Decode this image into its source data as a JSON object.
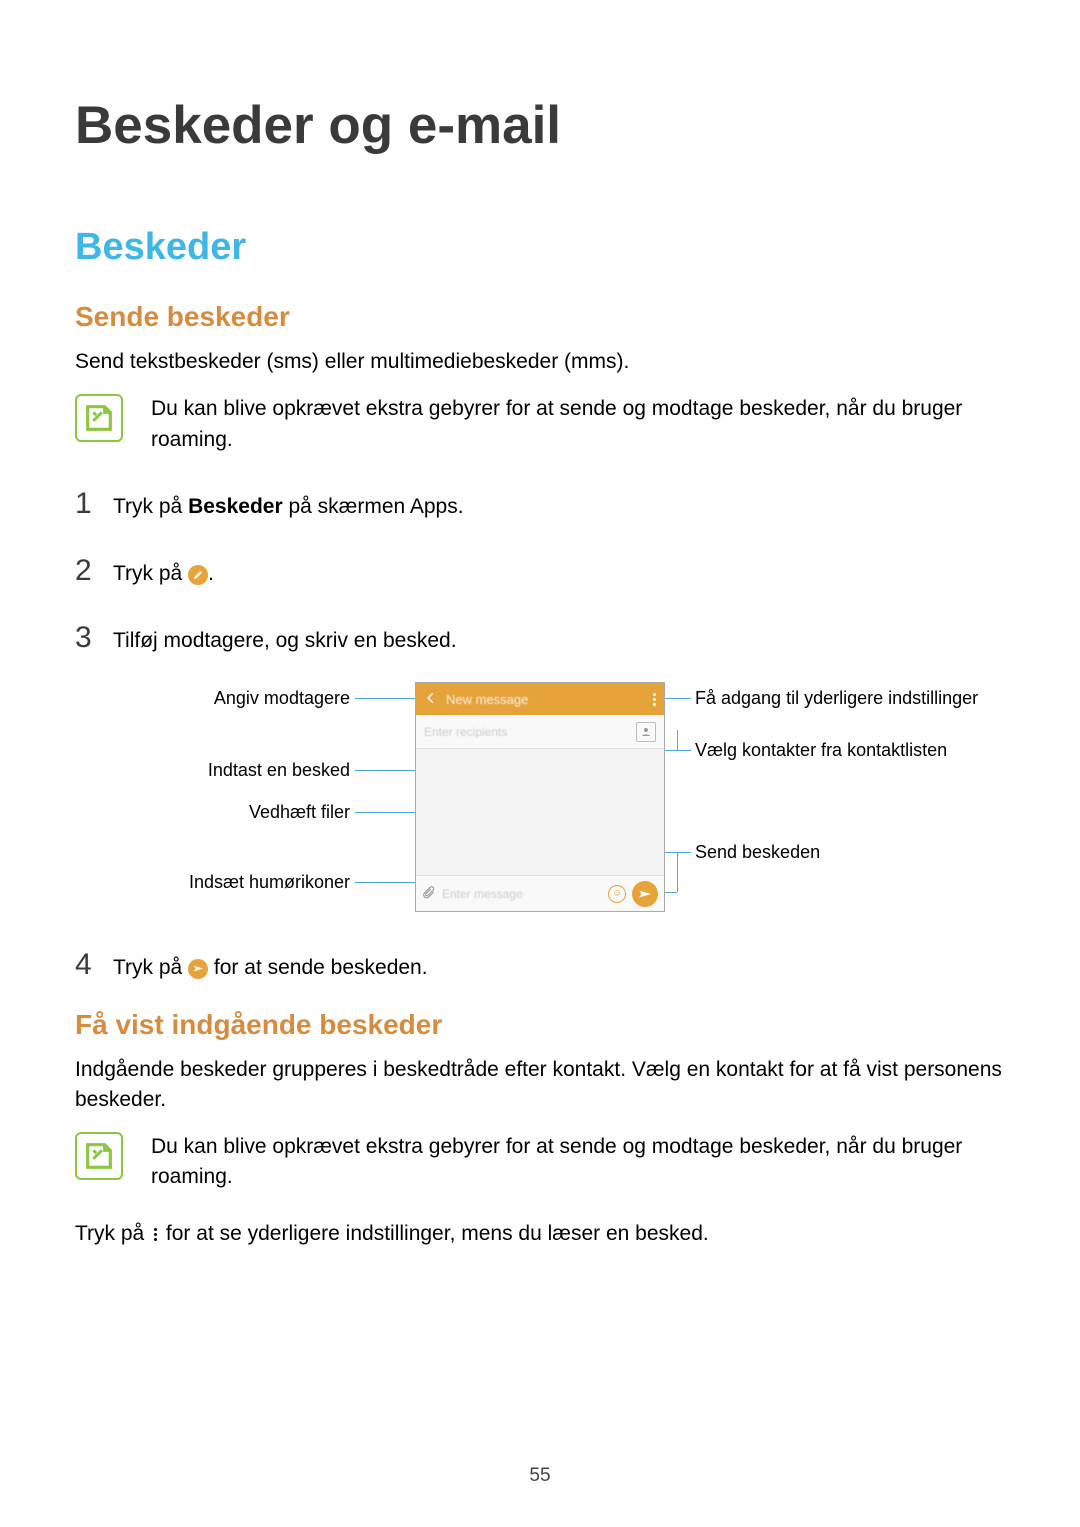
{
  "page_title": "Beskeder og e-mail",
  "section_title": "Beskeder",
  "send": {
    "heading": "Sende beskeder",
    "intro": "Send tekstbeskeder (sms) eller multimediebeskeder (mms).",
    "note": "Du kan blive opkrævet ekstra gebyrer for at sende og modtage beskeder, når du bruger roaming.",
    "step1_pre": "Tryk på ",
    "step1_bold": "Beskeder",
    "step1_post": " på skærmen Apps.",
    "step2": "Tryk på ",
    "step2_period": ".",
    "step3": "Tilføj modtagere, og skriv en besked.",
    "step4_pre": "Tryk på ",
    "step4_post": " for at sende beskeden."
  },
  "diagram": {
    "label_recipients": "Angiv modtagere",
    "label_enter_message": "Indtast en besked",
    "label_attach": "Vedhæft filer",
    "label_emoji": "Indsæt humørikoner",
    "label_more": "Få adgang til yderligere indstillinger",
    "label_contacts": "Vælg kontakter fra kontaktlisten",
    "label_send": "Send beskeden",
    "phone_header_title": "New message",
    "phone_recipients_placeholder": "Enter recipients",
    "phone_message_placeholder": "Enter message"
  },
  "view": {
    "heading": "Få vist indgående beskeder",
    "intro": "Indgående beskeder grupperes i beskedtråde efter kontakt. Vælg en kontakt for at få vist personens beskeder.",
    "note": "Du kan blive opkrævet ekstra gebyrer for at sende og modtage beskeder, når du bruger roaming.",
    "more_pre": "Tryk på ",
    "more_post": " for at se yderligere indstillinger, mens du læser en besked."
  },
  "page_number": "55"
}
